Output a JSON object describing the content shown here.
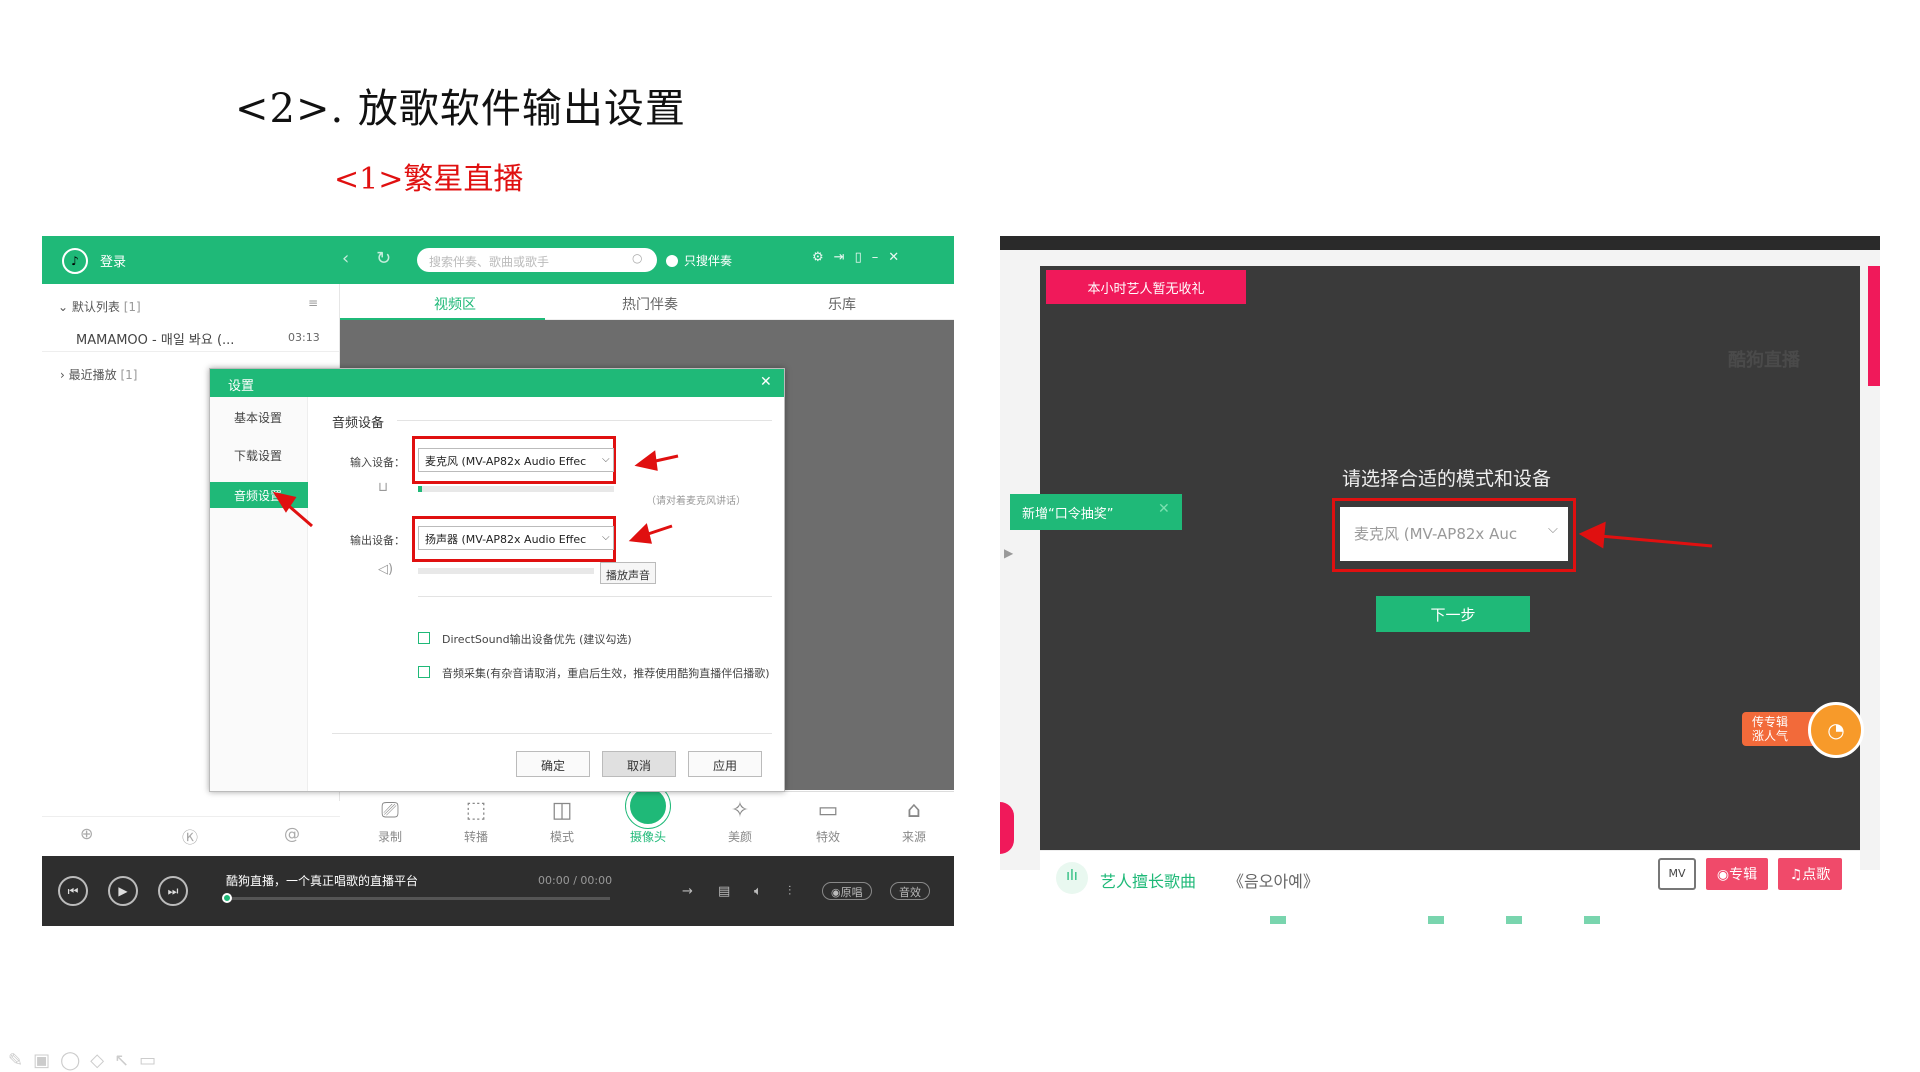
{
  "slide": {
    "title": "<2>. 放歌软件输出设置",
    "subtitle": "<1>繁星直播"
  },
  "left_app": {
    "topbar": {
      "login": "登录",
      "search_placeholder": "搜索伴奏、歌曲或歌手",
      "only_accompaniment": "只搜伴奏"
    },
    "playlist": {
      "default_list": "默认列表",
      "default_count": "[1]",
      "song_name": "MAMAMOO - 매일 봐요 (...",
      "song_time": "03:13",
      "recent": "最近播放",
      "recent_count": "[1]"
    },
    "tabs": [
      "视频区",
      "热门伴奏",
      "乐库"
    ],
    "toolbar": [
      {
        "label": "录制",
        "icon": "camera-record-icon"
      },
      {
        "label": "转播",
        "icon": "relay-icon"
      },
      {
        "label": "模式",
        "icon": "layout-icon"
      },
      {
        "label": "摄像头",
        "icon": "webcam-icon"
      },
      {
        "label": "美颜",
        "icon": "beauty-wand-icon"
      },
      {
        "label": "特效",
        "icon": "effects-monitor-icon"
      },
      {
        "label": "来源",
        "icon": "home-source-icon"
      }
    ],
    "player": {
      "title": "酷狗直播，一个真正唱歌的直播平台",
      "time": "00:00 / 00:00",
      "original": "原唱",
      "sound_effect": "音效"
    },
    "dialog": {
      "title": "设置",
      "side_items": [
        "基本设置",
        "下载设置",
        "音频设置"
      ],
      "section": "音频设备",
      "input_label": "输入设备：",
      "input_value": "麦克风 (MV-AP82x Audio Effec",
      "input_hint": "（请对着麦克风讲话）",
      "output_label": "输出设备：",
      "output_value": "扬声器 (MV-AP82x Audio Effec",
      "play_sound": "播放声音",
      "check1": "DirectSound输出设备优先 (建议勾选)",
      "check2": "音频采集(有杂音请取消，重启后生效，推荐使用酷狗直播伴侣播歌)",
      "ok": "确定",
      "cancel": "取消",
      "apply": "应用"
    }
  },
  "right_app": {
    "no_gift": "本小时艺人暂无收礼",
    "watermark": "酷狗直播",
    "prompt": "请选择合适的模式和设备",
    "select_value": "麦克风 (MV-AP82x Auc",
    "next": "下一步",
    "lottery_tag": "新增“口令抽奖”",
    "badge_line1": "传专辑",
    "badge_line2": "涨人气",
    "skill_label": "艺人擅长歌曲",
    "skill_song": "《음오아예》",
    "mv_label": "MV",
    "album_btn": "专辑",
    "request_btn": "点歌"
  },
  "colors": {
    "green": "#1fb978",
    "red_annotation": "#e01010",
    "pink": "#f0195a"
  }
}
